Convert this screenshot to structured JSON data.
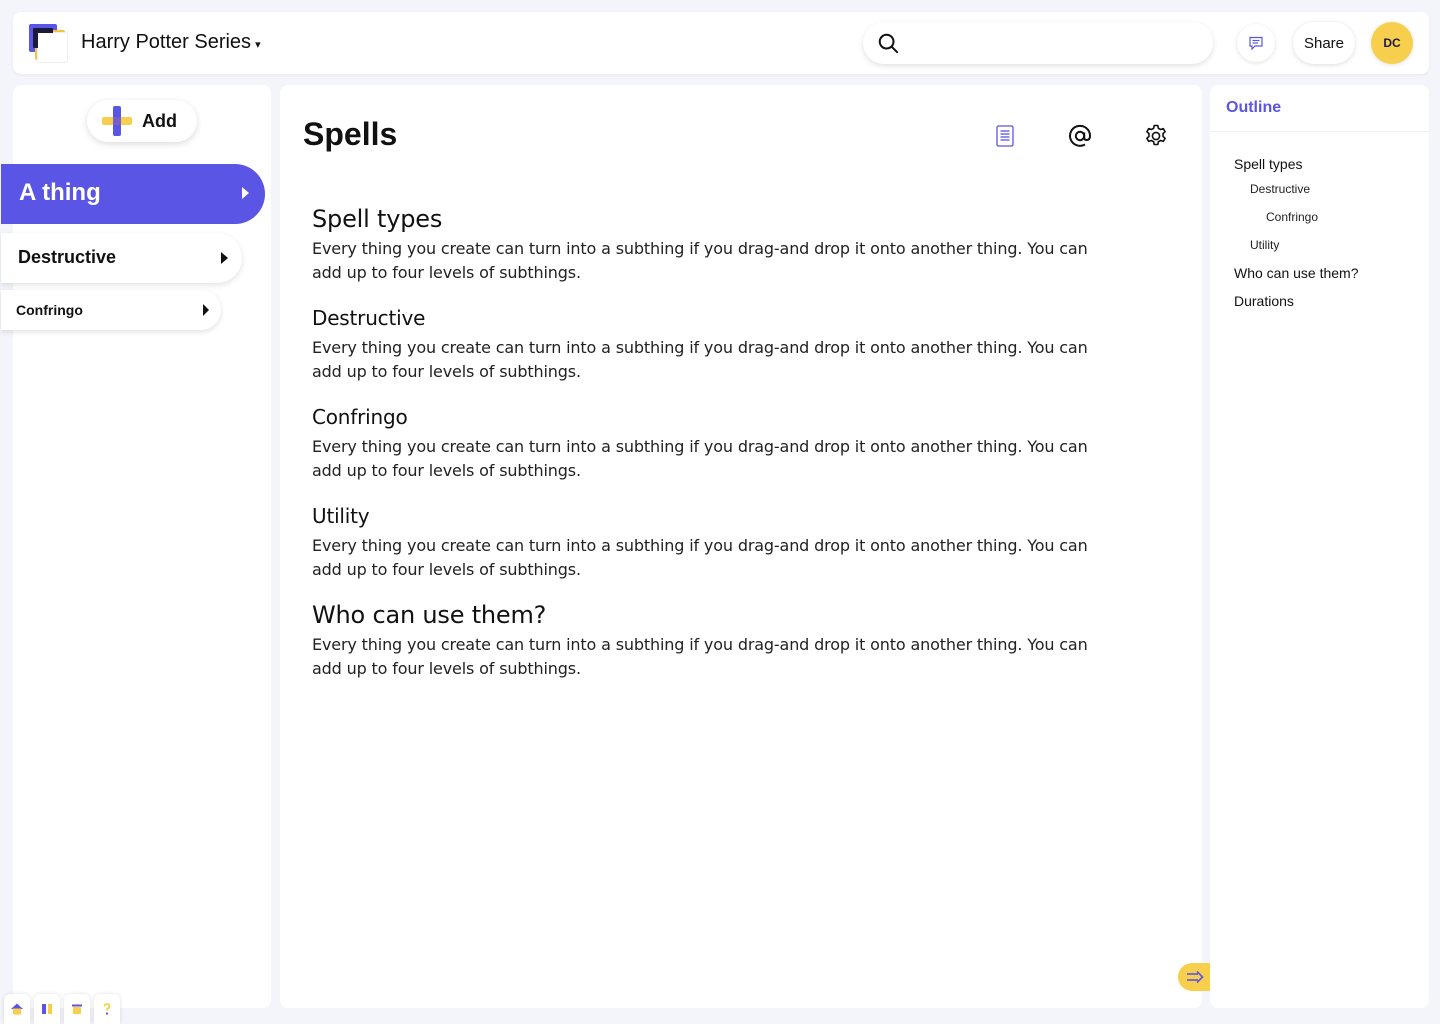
{
  "header": {
    "doc_title": "Harry Potter Series",
    "caret": "▾",
    "search_placeholder": "",
    "share_label": "Share",
    "avatar_initials": "DC"
  },
  "sidebar": {
    "add_label": "Add",
    "primary_item": "A thing",
    "secondary_item": "Destructive",
    "tertiary_item": "Confringo"
  },
  "main": {
    "page_title": "Spells",
    "sections": [
      {
        "heading": "Spell types",
        "body": "Every thing you create can turn into a subthing if you drag-and drop it onto another thing. You can add up to four levels of subthings."
      },
      {
        "heading": "Destructive",
        "body": "Every thing you create can turn into a subthing if you drag-and drop it onto another thing. You can add up to four levels of subthings."
      },
      {
        "heading": "Confringo",
        "body": "Every thing you create can turn into a subthing if you drag-and drop it onto another thing. You can add up to four levels of subthings."
      },
      {
        "heading": "Utility",
        "body": "Every thing you create can turn into a subthing if you drag-and drop it onto another thing. You can add up to four levels of subthings."
      },
      {
        "heading": "Who can use them?",
        "body": "Every thing you create can turn into a subthing if you drag-and drop it onto another thing. You can add up to four levels of subthings."
      }
    ]
  },
  "outline": {
    "title": "Outline",
    "items": [
      "Spell types",
      "Destructive",
      "Confringo",
      "Utility",
      "Who can use them?",
      "Durations"
    ]
  },
  "colors": {
    "accent": "#5b55e6",
    "yellow": "#f8cf4d",
    "background": "#f4f4fb"
  }
}
